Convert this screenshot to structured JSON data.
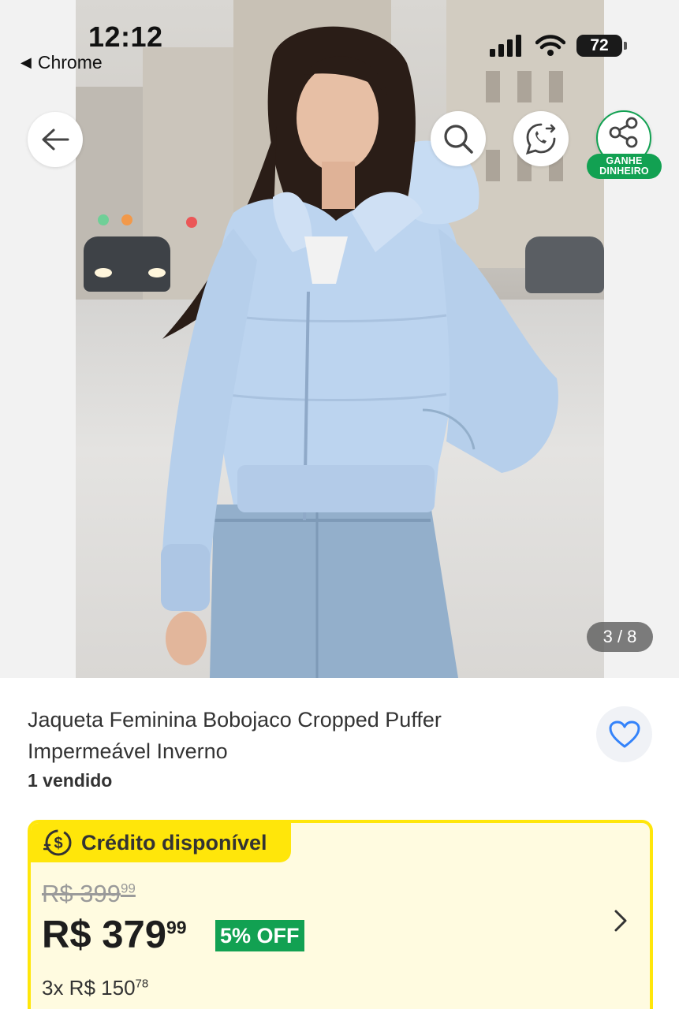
{
  "status_bar": {
    "time": "12:12",
    "back_app": "Chrome",
    "battery": "72"
  },
  "image_viewer": {
    "counter": "3 / 8",
    "share_badge_line1": "GANHE",
    "share_badge_line2": "DINHEIRO"
  },
  "product": {
    "title": "Jaqueta Feminina Bobojaco Cropped Puffer Impermeável Inverno",
    "sold": "1 vendido"
  },
  "credit": {
    "label": "Crédito disponível",
    "old_price": "R$ 399",
    "old_price_cents": "99",
    "price": "R$ 379",
    "price_cents": "99",
    "discount": "5% OFF",
    "installments": "3x R$ 150",
    "installments_cents": "78"
  },
  "colors": {
    "accent_green": "#12a152",
    "credit_yellow": "#ffe60a",
    "favorite_blue": "#3483fa"
  },
  "icons": [
    "back-arrow-icon",
    "search-icon",
    "whatsapp-icon",
    "share-icon",
    "heart-icon",
    "dollar-coin-icon",
    "chevron-right-icon",
    "signal-icon",
    "wifi-icon",
    "battery-icon"
  ]
}
